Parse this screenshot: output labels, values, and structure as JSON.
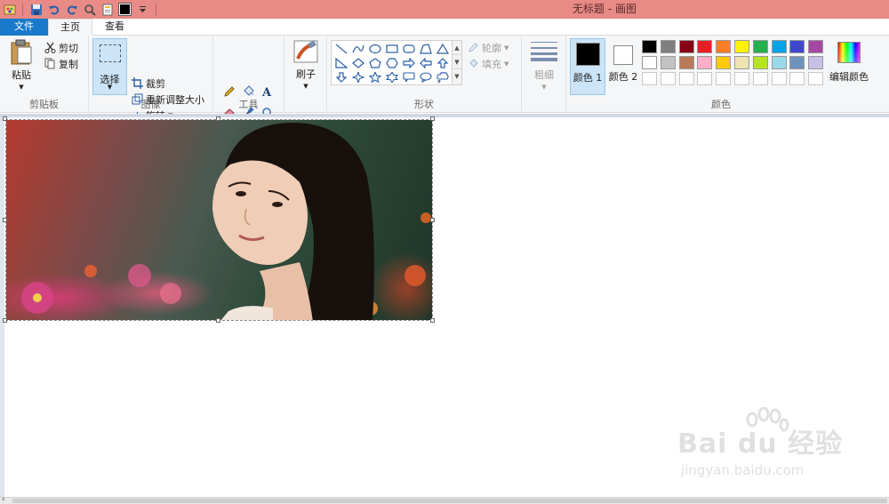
{
  "window": {
    "title": "无标题 - 画图"
  },
  "tabs": {
    "file": "文件",
    "home": "主页",
    "view": "查看"
  },
  "clipboard": {
    "paste": "粘贴",
    "cut": "剪切",
    "copy": "复制",
    "label": "剪贴板"
  },
  "image": {
    "select": "选择",
    "crop": "裁剪",
    "resize": "重新调整大小",
    "rotate": "旋转",
    "label": "图像"
  },
  "tools": {
    "label": "工具"
  },
  "brushes": {
    "label": "刷子"
  },
  "shapes": {
    "outline": "轮廓",
    "fill": "填充",
    "label": "形状"
  },
  "size": {
    "label": "粗细"
  },
  "colors": {
    "color1": "颜色 1",
    "color2": "颜色 2",
    "edit": "编辑颜色",
    "label": "颜色",
    "current1": "#000000",
    "current2": "#ffffff",
    "palette_row1": [
      "#000000",
      "#7f7f7f",
      "#880015",
      "#ed1c24",
      "#ff7f27",
      "#fff200",
      "#22b14c",
      "#00a2e8",
      "#3f48cc",
      "#a349a4"
    ],
    "palette_row2": [
      "#ffffff",
      "#c3c3c3",
      "#b97a57",
      "#ffaec9",
      "#ffc90e",
      "#efe4b0",
      "#b5e61d",
      "#99d9ea",
      "#7092be",
      "#c8bfe7"
    ]
  },
  "watermark": {
    "brand": "Bai du 经验",
    "url": "jingyan.baidu.com"
  }
}
